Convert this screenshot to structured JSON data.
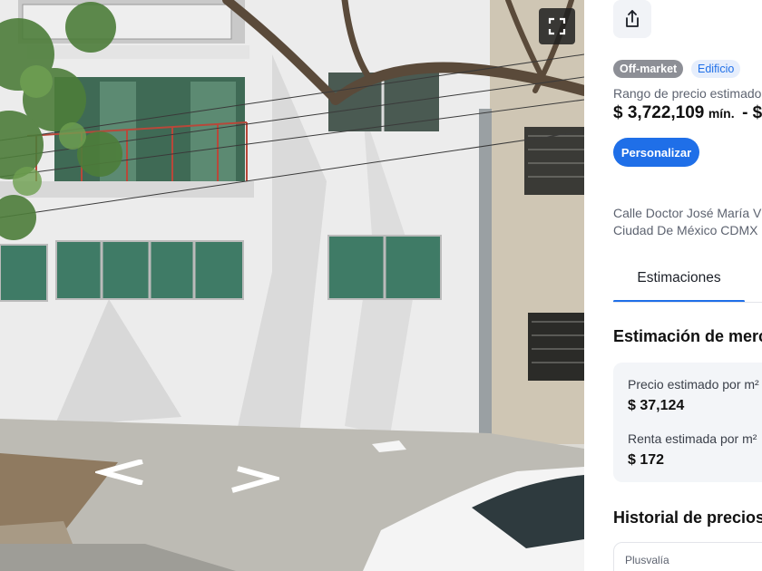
{
  "photo": {
    "alt": "",
    "expand_icon": "fullscreen-icon",
    "nav_left_icon": "chevron-left-icon",
    "nav_right_icon": "chevron-right-icon"
  },
  "panel": {
    "share_icon": "share-icon",
    "badges": {
      "status": "Off-market",
      "type": "Edificio"
    },
    "price_range": {
      "label": "Rango de precio estimado",
      "min_amount": "$ 3,722,109",
      "min_unit": "mín.",
      "separator": "- $"
    },
    "customize_button": "Personalizar",
    "address": {
      "line1": "Calle Doctor José María V",
      "line2": "Ciudad De México CDMX"
    },
    "tabs": {
      "estimations": "Estimaciones"
    },
    "market": {
      "title": "Estimación de merc",
      "price_m2_label": "Precio estimado por m²",
      "price_m2_value": "$ 37,124",
      "rent_m2_label": "Renta estimada por m²",
      "rent_m2_value": "$ 172"
    },
    "history": {
      "title": "Historial de precios",
      "card_label": "Plusvalía"
    }
  },
  "colors": {
    "accent": "#1f6fe8",
    "badge_off_market": "#8d8f96",
    "card_background": "#f3f5f8"
  }
}
